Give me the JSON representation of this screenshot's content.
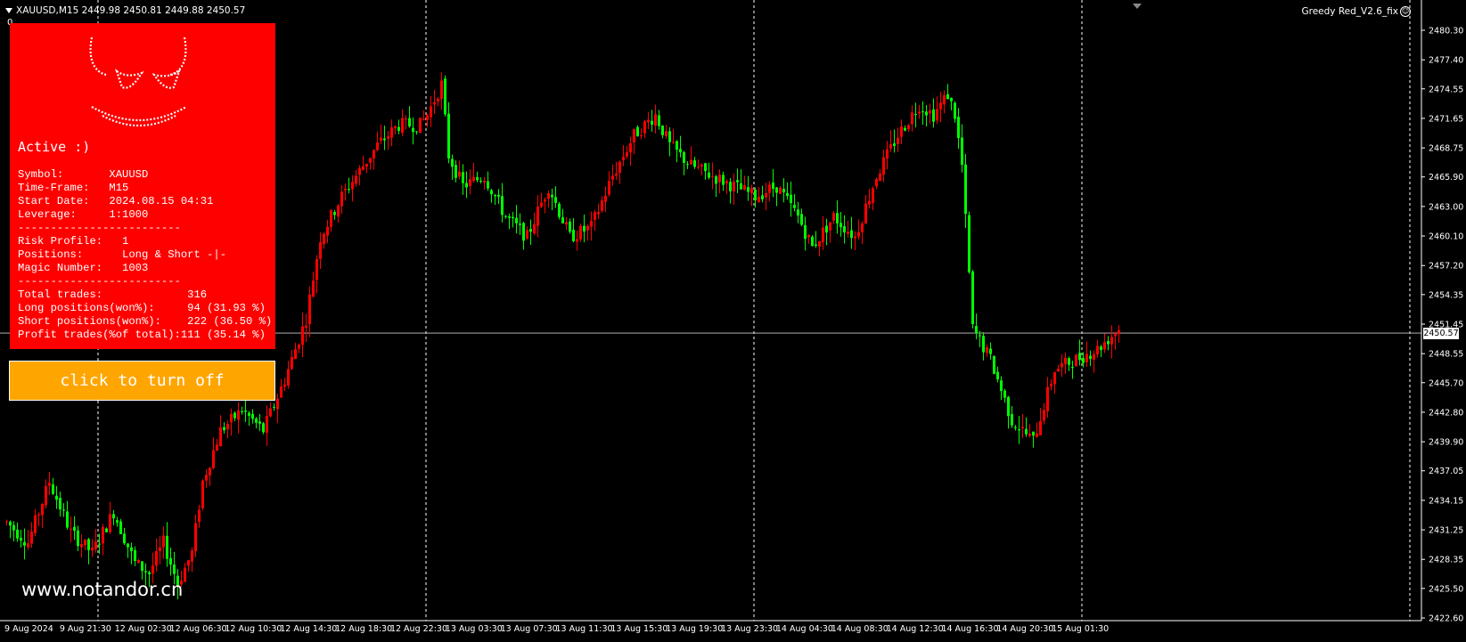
{
  "header": {
    "symbol_line": "XAUUSD,M15  2449.98 2450.81 2449.88 2450.57",
    "zero_label": "0"
  },
  "expert": {
    "name": "Greedy Red_V2.6_fix",
    "icon": "smiley-icon"
  },
  "panel": {
    "status": "Active :)",
    "lines": [
      "Symbol:       XAUUSD",
      "Time-Frame:   M15",
      "Start Date:   2024.08.15 04:31",
      "Leverage:     1:1000",
      "-------------------------",
      "Risk Profile:   1",
      "Positions:      Long & Short -|-",
      "Magic Number:   1003",
      "-------------------------",
      "Total trades:             316",
      "Long positions(won%):     94 (31.93 %)",
      "Short positions(won%):    222 (36.50 %)",
      "Profit trades(%of total):111 (35.14 %)"
    ],
    "colors": {
      "panel": "#ff0000",
      "button": "#ffa500"
    }
  },
  "button": {
    "label": "click to turn off"
  },
  "watermark": "www.notandor.cn",
  "chart_data": {
    "type": "candlestick",
    "symbol": "XAUUSD",
    "timeframe": "M15",
    "current_price": "2450.57",
    "ylim": [
      2422.6,
      2480.3
    ],
    "price_ticks": [
      "2480.30",
      "2477.40",
      "2474.55",
      "2471.65",
      "2468.75",
      "2465.90",
      "2463.00",
      "2460.10",
      "2457.20",
      "2454.35",
      "2451.45",
      "2448.55",
      "2445.70",
      "2442.80",
      "2439.90",
      "2437.05",
      "2434.15",
      "2431.25",
      "2428.35",
      "2425.50",
      "2422.60"
    ],
    "time_ticks": [
      "9 Aug 2024",
      "9 Aug 21:30",
      "12 Aug 02:30",
      "12 Aug 06:30",
      "12 Aug 10:30",
      "12 Aug 14:30",
      "12 Aug 18:30",
      "12 Aug 22:30",
      "13 Aug 03:30",
      "13 Aug 07:30",
      "13 Aug 11:30",
      "13 Aug 15:30",
      "13 Aug 19:30",
      "13 Aug 23:30",
      "14 Aug 04:30",
      "14 Aug 08:30",
      "14 Aug 12:30",
      "14 Aug 16:30",
      "14 Aug 20:30",
      "15 Aug 01:30"
    ],
    "path": [
      [
        0,
        2432
      ],
      [
        6,
        2430
      ],
      [
        12,
        2436
      ],
      [
        18,
        2431
      ],
      [
        24,
        2429
      ],
      [
        30,
        2433
      ],
      [
        36,
        2428
      ],
      [
        40,
        2427
      ],
      [
        44,
        2430
      ],
      [
        48,
        2426
      ],
      [
        52,
        2429
      ],
      [
        55,
        2436
      ],
      [
        60,
        2441
      ],
      [
        66,
        2443
      ],
      [
        72,
        2441
      ],
      [
        78,
        2446
      ],
      [
        84,
        2452
      ],
      [
        88,
        2460
      ],
      [
        94,
        2464
      ],
      [
        98,
        2466
      ],
      [
        104,
        2469
      ],
      [
        110,
        2471
      ],
      [
        116,
        2471
      ],
      [
        118,
        2472
      ],
      [
        122,
        2475
      ],
      [
        124,
        2468
      ],
      [
        128,
        2465
      ],
      [
        134,
        2466
      ],
      [
        140,
        2462
      ],
      [
        146,
        2460
      ],
      [
        152,
        2465
      ],
      [
        158,
        2460
      ],
      [
        164,
        2461
      ],
      [
        170,
        2466
      ],
      [
        176,
        2470
      ],
      [
        182,
        2472
      ],
      [
        186,
        2469
      ],
      [
        192,
        2467
      ],
      [
        198,
        2466
      ],
      [
        204,
        2465
      ],
      [
        210,
        2464
      ],
      [
        216,
        2465
      ],
      [
        222,
        2462
      ],
      [
        226,
        2459
      ],
      [
        232,
        2462
      ],
      [
        238,
        2460
      ],
      [
        244,
        2466
      ],
      [
        250,
        2470
      ],
      [
        256,
        2473
      ],
      [
        260,
        2472
      ],
      [
        264,
        2474
      ],
      [
        266,
        2472
      ],
      [
        268,
        2467
      ],
      [
        271,
        2451
      ],
      [
        276,
        2448
      ],
      [
        282,
        2442
      ],
      [
        288,
        2440
      ],
      [
        294,
        2447
      ],
      [
        300,
        2448
      ],
      [
        306,
        2449
      ],
      [
        312,
        2451
      ]
    ],
    "colors": {
      "bull": "#ff0000",
      "bear": "#00ff00",
      "grid": "#ffffff",
      "price_line": "#c8c8c8"
    }
  }
}
